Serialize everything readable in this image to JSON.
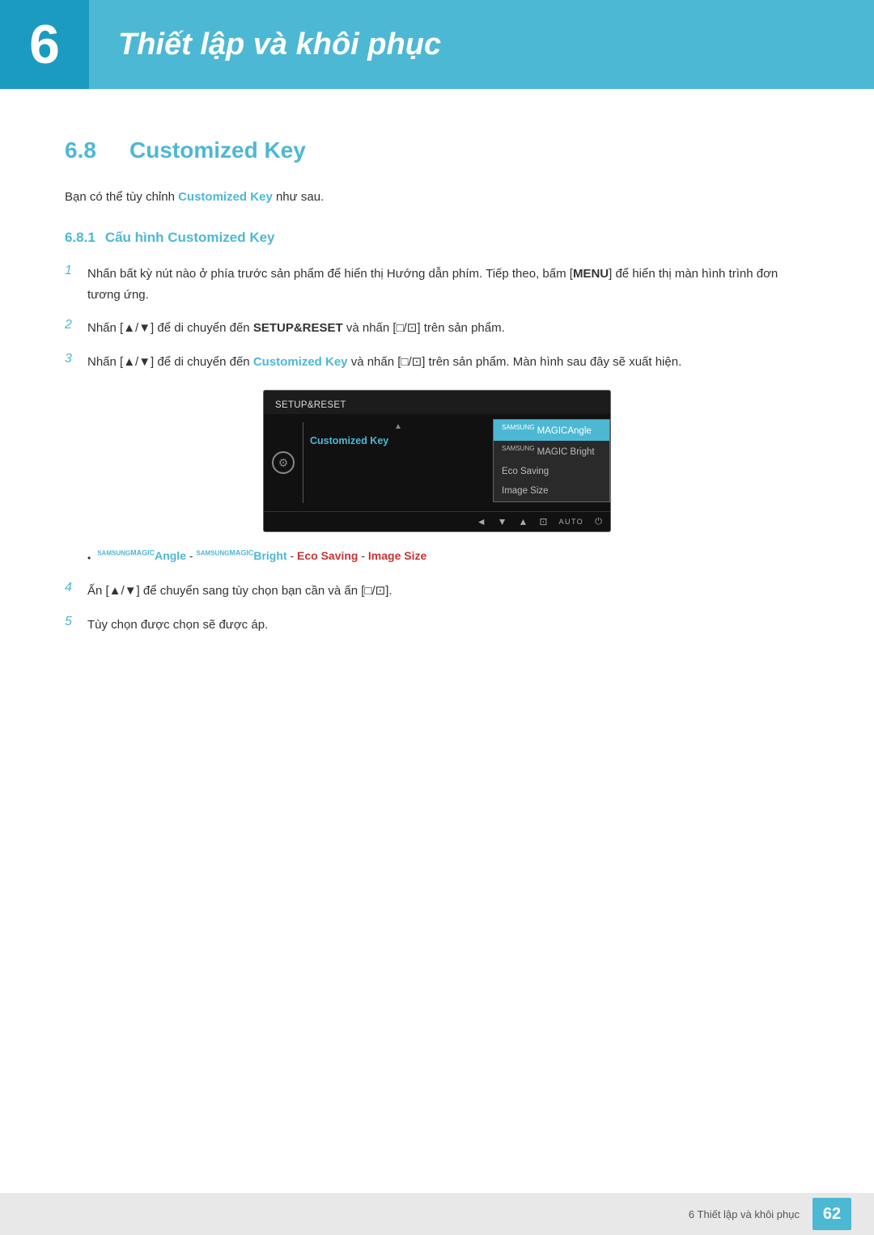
{
  "chapter": {
    "number": "6",
    "title": "Thiết lập và khôi phục"
  },
  "section": {
    "number": "6.8",
    "title": "Customized Key"
  },
  "intro": {
    "text_before": "Bạn có thể tùy chỉnh ",
    "bold_term": "Customized Key",
    "text_after": " như sau."
  },
  "subsection": {
    "number": "6.8.1",
    "title": "Cấu hình Customized Key"
  },
  "steps": [
    {
      "number": "1",
      "text": "Nhấn bất kỳ nút nào ở phía trước sản phẩm để hiển thị Hướng dẫn phím. Tiếp theo, bấm [",
      "bold_part": "MENU",
      "text_after": "] để hiển thị màn hình trình đơn tương ứng."
    },
    {
      "number": "2",
      "text": "Nhấn [▲/▼] để di chuyển đến ",
      "bold_part": "SETUP&RESET",
      "text_after": " và nhấn [□/⊡] trên sản phẩm."
    },
    {
      "number": "3",
      "text_before": "Nhấn [▲/▼] để di chuyển đến ",
      "bold_term": "Customized Key",
      "text_after": " và nhấn [□/⊡] trên sản phẩm. Màn hình sau đây sẽ xuất hiện."
    }
  ],
  "monitor": {
    "top_label": "SETUP&RESET",
    "menu_item": "Customized Key",
    "submenu_items": [
      {
        "brand": "SAMSUNG",
        "magic": "MAGIC",
        "name": "Angle",
        "highlighted": true
      },
      {
        "brand": "SAMSUNG",
        "magic": "MAGIC",
        "name": "Bright",
        "highlighted": false
      },
      {
        "name": "Eco Saving",
        "highlighted": false
      },
      {
        "name": "Image Size",
        "highlighted": false
      }
    ],
    "footer_buttons": [
      "◄",
      "▼",
      "▲",
      "⊡",
      "AUTO",
      "⏻"
    ]
  },
  "bullet": {
    "items": [
      {
        "prefix_brand": "SAMSUNG",
        "prefix_magic": "MAGIC",
        "prefix_name": "Angle",
        "separator": " - ",
        "brand2": "SAMSUNG",
        "magic2": "MAGIC",
        "name2": "Bright",
        "rest": " - Eco Saving - Image Size"
      }
    ]
  },
  "steps_4_5": [
    {
      "number": "4",
      "text": "Ấn [▲/▼] để chuyển sang tùy chọn bạn cần và ấn [□/⊡]."
    },
    {
      "number": "5",
      "text": "Tùy chọn được chọn sẽ được áp."
    }
  ],
  "footer": {
    "chapter_ref": "6 Thiết lập và khôi phục",
    "page_number": "62"
  }
}
